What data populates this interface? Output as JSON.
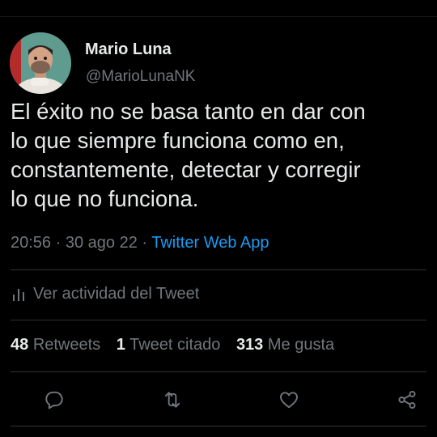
{
  "author": {
    "name": "Mario Luna",
    "handle": "@MarioLunaNK",
    "avatar_icon": "profile-photo"
  },
  "tweet": {
    "lines": [
      "El éxito no se basa tanto en dar con",
      "lo que siempre funciona como en,",
      "constantemente, detectar y corregir",
      "lo que no funciona."
    ]
  },
  "meta": {
    "time": "20:56",
    "separator1": " · ",
    "date": "30 ago 22",
    "separator2": " · ",
    "source": "Twitter Web App"
  },
  "activity": {
    "icon": "bar-chart-icon",
    "label": "Ver actividad del Tweet"
  },
  "stats": {
    "retweets_count": "48",
    "retweets_label": "Retweets",
    "quotes_count": "1",
    "quotes_label": "Tweet citado",
    "likes_count": "313",
    "likes_label": "Me gusta"
  },
  "actions": {
    "icons": [
      "reply-icon",
      "retweet-icon",
      "like-icon",
      "share-icon"
    ]
  },
  "colors": {
    "background": "#000000",
    "text_primary": "#e7e9ea",
    "text_secondary": "#71767b",
    "link": "#1d9bf0",
    "divider": "#2f3336"
  }
}
